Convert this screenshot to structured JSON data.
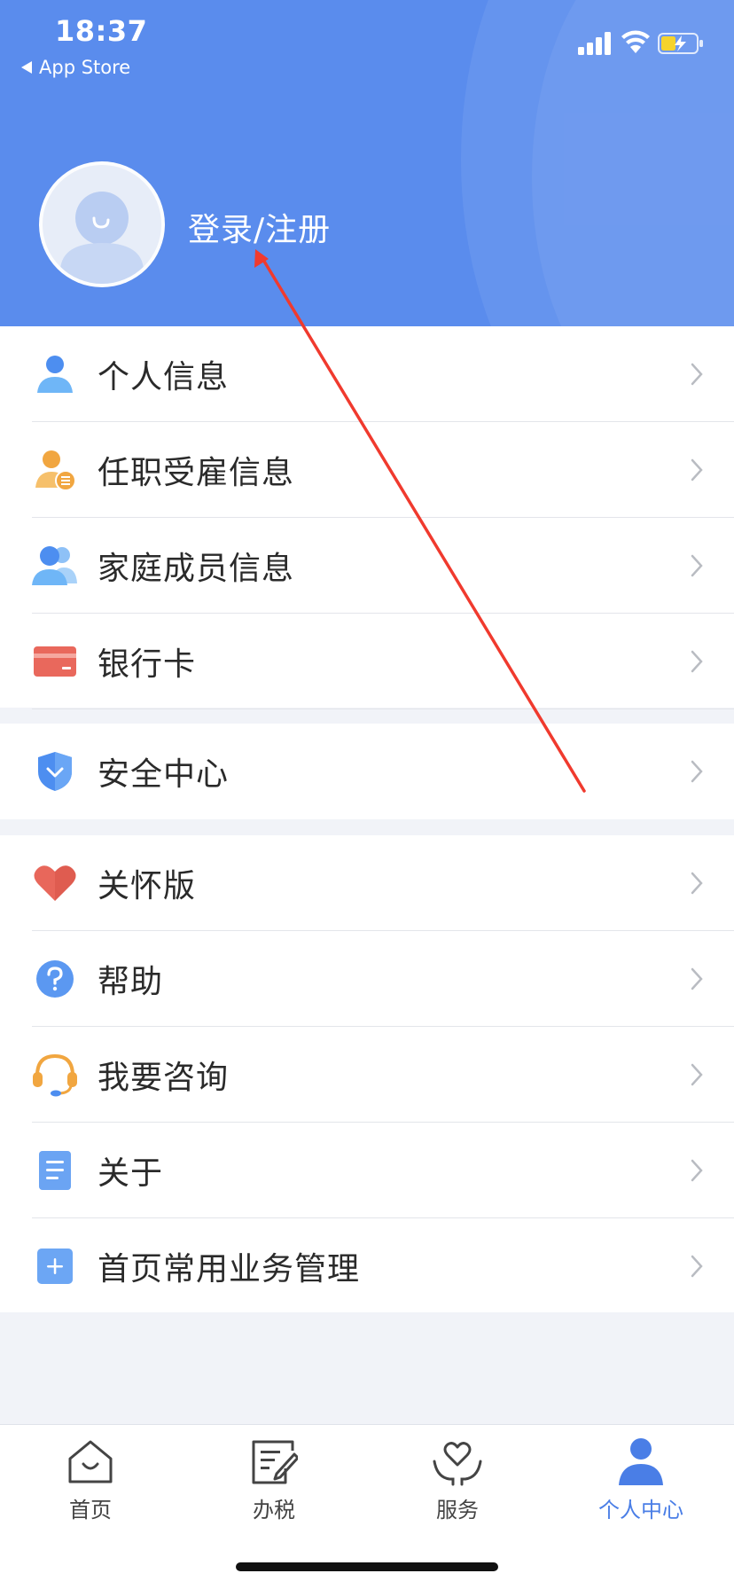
{
  "status_bar": {
    "time": "18:37",
    "back_app": "App Store"
  },
  "header": {
    "login_label": "登录/注册",
    "avatar_icon": "user-avatar-icon"
  },
  "menu_groups": [
    [
      {
        "label": "个人信息",
        "icon": "person-icon"
      },
      {
        "label": "任职受雇信息",
        "icon": "employment-icon"
      },
      {
        "label": "家庭成员信息",
        "icon": "family-icon"
      },
      {
        "label": "银行卡",
        "icon": "bank-card-icon"
      }
    ],
    [
      {
        "label": "安全中心",
        "icon": "shield-icon"
      }
    ],
    [
      {
        "label": "关怀版",
        "icon": "heart-icon"
      },
      {
        "label": "帮助",
        "icon": "help-icon"
      },
      {
        "label": "我要咨询",
        "icon": "headset-icon"
      },
      {
        "label": "关于",
        "icon": "document-icon"
      },
      {
        "label": "首页常用业务管理",
        "icon": "add-square-icon"
      }
    ]
  ],
  "tabbar": {
    "tabs": [
      {
        "label": "首页",
        "icon": "home-icon",
        "active": false
      },
      {
        "label": "办税",
        "icon": "tax-edit-icon",
        "active": false
      },
      {
        "label": "服务",
        "icon": "service-heart-icon",
        "active": false
      },
      {
        "label": "个人中心",
        "icon": "person-center-icon",
        "active": true
      }
    ]
  },
  "colors": {
    "header_bg": "#5a8ced",
    "accent": "#4a7ee6",
    "page_bg": "#f1f3f8",
    "annotation_arrow": "#f03a2e"
  }
}
